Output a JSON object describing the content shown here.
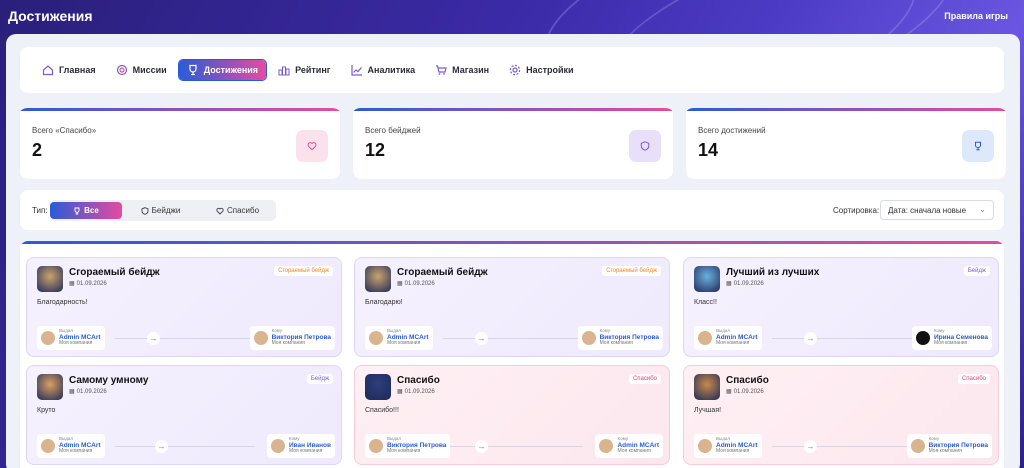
{
  "header": {
    "title": "Достижения",
    "rules": "Правила игры"
  },
  "nav": {
    "items": [
      {
        "label": "Главная",
        "icon": "home-icon"
      },
      {
        "label": "Миссии",
        "icon": "target-icon"
      },
      {
        "label": "Достижения",
        "icon": "trophy-icon",
        "active": true
      },
      {
        "label": "Рейтинг",
        "icon": "podium-icon"
      },
      {
        "label": "Аналитика",
        "icon": "chart-icon"
      },
      {
        "label": "Магазин",
        "icon": "cart-icon"
      },
      {
        "label": "Настройки",
        "icon": "gear-icon"
      }
    ]
  },
  "stats": [
    {
      "label": "Всего «Спасибо»",
      "value": "2",
      "icon": "heart-icon",
      "color": "#e64ba0"
    },
    {
      "label": "Всего бейджей",
      "value": "12",
      "icon": "shield-icon",
      "color": "#7a5bd7"
    },
    {
      "label": "Всего достижений",
      "value": "14",
      "icon": "trophy-icon",
      "color": "#2a5bd7"
    }
  ],
  "filter": {
    "type_label": "Тип:",
    "options": [
      "Все",
      "Бейджи",
      "Спасибо"
    ],
    "active": "Все",
    "sort_label": "Сортировка:",
    "sort_value": "Дата: сначала новые"
  },
  "achievements": [
    {
      "title": "Сгораемый бейдж",
      "date": "01.09.2026",
      "badge": "Сгораемый бейдж",
      "badge_color": "#f08a24",
      "message": "Благодарность!",
      "from_role": "Выдал",
      "from_name": "Admin MCArt",
      "from_company": "Моя компания",
      "to_role": "Кому",
      "to_name": "Виктория Петрова",
      "to_company": "Моя компания",
      "style": "purple"
    },
    {
      "title": "Сгораемый бейдж",
      "date": "01.09.2026",
      "badge": "Сгораемый бейдж",
      "badge_color": "#f08a24",
      "message": "Благодарю!",
      "from_role": "Выдал",
      "from_name": "Admin MCArt",
      "from_company": "Моя компания",
      "to_role": "Кому",
      "to_name": "Виктория Петрова",
      "to_company": "Моя компания",
      "style": "purple"
    },
    {
      "title": "Лучший из лучших",
      "date": "01.09.2026",
      "badge": "Бейдж",
      "badge_color": "#7a5bd7",
      "message": "Класс!!",
      "from_role": "Выдал",
      "from_name": "Admin MCArt",
      "from_company": "Моя компания",
      "to_role": "Кому",
      "to_name": "Ирина Семенова",
      "to_company": "Моя компания",
      "style": "purple"
    },
    {
      "title": "Самому умному",
      "date": "01.09.2026",
      "badge": "Бейдж",
      "badge_color": "#7a5bd7",
      "message": "Круто",
      "from_role": "Выдал",
      "from_name": "Admin MCArt",
      "from_company": "Моя компания",
      "to_role": "Кому",
      "to_name": "Иван Иванов",
      "to_company": "Моя компания",
      "style": "purple"
    },
    {
      "title": "Спасибо",
      "date": "01.09.2026",
      "badge": "Спасибо",
      "badge_color": "#e0407a",
      "message": "Спасибо!!!",
      "from_role": "Выдал",
      "from_name": "Виктория Петрова",
      "from_company": "Моя компания",
      "to_role": "Кому",
      "to_name": "Admin MCArt",
      "to_company": "Моя компания",
      "style": "pink"
    },
    {
      "title": "Спасибо",
      "date": "01.09.2026",
      "badge": "Спасибо",
      "badge_color": "#e0407a",
      "message": "Лучшая!",
      "from_role": "Выдал",
      "from_name": "Admin MCArt",
      "from_company": "Моя компания",
      "to_role": "Кому",
      "to_name": "Виктория Петрова",
      "to_company": "Моя компания",
      "style": "pink"
    }
  ]
}
